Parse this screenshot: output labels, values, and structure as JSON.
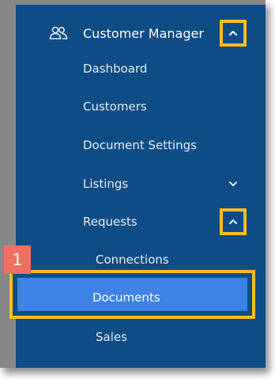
{
  "menu": {
    "header_label": "Customer Manager",
    "items": [
      {
        "label": "Dashboard"
      },
      {
        "label": "Customers"
      },
      {
        "label": "Document Settings"
      },
      {
        "label": "Listings"
      },
      {
        "label": "Requests"
      }
    ],
    "sub_items": [
      {
        "label": "Connections"
      },
      {
        "label": "Documents"
      },
      {
        "label": "Sales"
      }
    ]
  },
  "annotation": {
    "step_number": "1"
  },
  "colors": {
    "sidebar_bg": "#0d4c85",
    "active_bg": "#3d82e4",
    "highlight_border": "#f5c018",
    "badge_bg": "#f07063"
  },
  "icons": {
    "header": "users-icon",
    "collapse": "chevron-up-icon",
    "expand": "chevron-down-icon"
  }
}
